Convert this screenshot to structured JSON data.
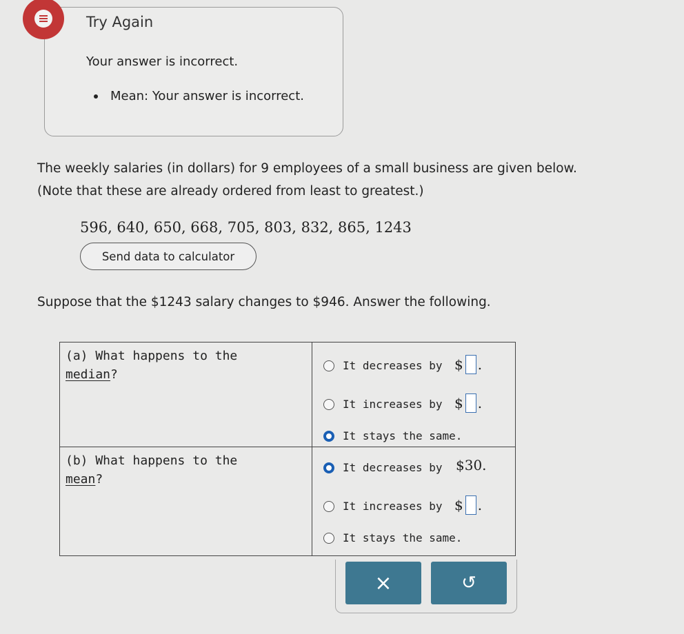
{
  "feedback": {
    "title": "Try Again",
    "message": "Your answer is incorrect.",
    "bullet": "Mean: Your answer is incorrect."
  },
  "problem": {
    "line1": "The weekly salaries (in dollars) for 9 employees of a small business are given below.",
    "line2": "(Note that these are already ordered from least to greatest.)",
    "data": "596, 640, 650, 668, 705, 803, 832, 865, 1243",
    "send_button": "Send data to calculator",
    "question": "Suppose that the $1243 salary changes to $946. Answer the following."
  },
  "part_a": {
    "label_prefix": "(a) What happens to the",
    "label_link": "median",
    "label_suffix": "?",
    "options": [
      {
        "text": "It decreases by",
        "selected": false,
        "amount": "$"
      },
      {
        "text": "It increases by",
        "selected": false,
        "amount": "$"
      },
      {
        "text": "It stays the same.",
        "selected": true
      }
    ]
  },
  "part_b": {
    "label_prefix": "(b) What happens to the",
    "label_link": "mean",
    "label_suffix": "?",
    "options": [
      {
        "text": "It decreases by",
        "selected": true,
        "amount": "$30."
      },
      {
        "text": "It increases by",
        "selected": false,
        "amount": "$"
      },
      {
        "text": "It stays the same.",
        "selected": false
      }
    ]
  },
  "actions": {
    "clear_label": "×",
    "undo_label": "↺"
  },
  "colors": {
    "error": "#c23636",
    "radio_selected": "#1a5fb4",
    "action_button": "#3e7891"
  },
  "icons": {
    "feedback": "error-list-icon",
    "clear": "close-icon",
    "undo": "undo-icon"
  }
}
